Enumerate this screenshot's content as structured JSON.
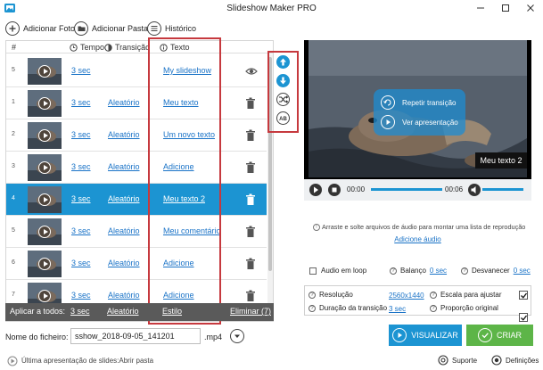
{
  "window": {
    "title": "Slideshow Maker PRO"
  },
  "toolbar": {
    "add_photo": "Adicionar Foto",
    "add_folder": "Adicionar Pasta",
    "history": "Histórico"
  },
  "table": {
    "headers": {
      "index": "#",
      "time": "Tempo",
      "transition": "Transição",
      "text": "Texto"
    },
    "rows": [
      {
        "index": "5",
        "time": "3 sec",
        "transition": "",
        "text": "My slideshow",
        "action": "eye-icon",
        "selected": false
      },
      {
        "index": "1",
        "time": "3 sec",
        "transition": "Aleatório",
        "text": "Meu texto",
        "action": "trash-icon",
        "selected": false
      },
      {
        "index": "2",
        "time": "3 sec",
        "transition": "Aleatório",
        "text": "Um novo texto",
        "action": "trash-icon",
        "selected": false
      },
      {
        "index": "3",
        "time": "3 sec",
        "transition": "Aleatório",
        "text": "Adicione",
        "action": "trash-icon",
        "selected": false
      },
      {
        "index": "4",
        "time": "3 sec",
        "transition": "Aleatório",
        "text": "Meu texto 2",
        "action": "trash-icon",
        "selected": true
      },
      {
        "index": "5",
        "time": "3 sec",
        "transition": "Aleatório",
        "text": "Meu comentário",
        "action": "trash-icon",
        "selected": false
      },
      {
        "index": "6",
        "time": "3 sec",
        "transition": "Aleatório",
        "text": "Adicione",
        "action": "trash-icon",
        "selected": false
      },
      {
        "index": "7",
        "time": "3 sec",
        "transition": "Aleatório",
        "text": "Adicione",
        "action": "trash-icon",
        "selected": false
      }
    ]
  },
  "side_tools": [
    "arrow-up-icon",
    "arrow-down-icon",
    "shuffle-icon",
    "ab-text-icon"
  ],
  "apply_all": {
    "label": "Aplicar a todos:",
    "time": "3 sec",
    "transition": "Aleatório",
    "style": "Estilo",
    "remove": "Eliminar (7)"
  },
  "filename": {
    "label": "Nome do ficheiro:",
    "value": "sshow_2018-09-05_141201",
    "extension": ".mp4"
  },
  "preview": {
    "caption": "Meu texto 2",
    "overlay_repeat": "Repetir transição",
    "overlay_view": "Ver apresentação",
    "time_current": "00:00",
    "time_total": "00:06",
    "progress": 0,
    "volume": 1
  },
  "audio": {
    "drop_hint": "Arraste e solte arquivos de áudio para montar uma lista de reprodução",
    "add_link": "Adicione áudio",
    "loop_label": "Audio em loop",
    "balance_label": "Balanço",
    "balance_value": "0 sec",
    "fade_label": "Desvanecer",
    "fade_value": "0 sec"
  },
  "settings": {
    "resolution_label": "Resolução",
    "resolution_value": "2560x1440",
    "duration_label": "Duração da transição",
    "duration_value": "3 sec",
    "scale_label": "Escala para ajustar",
    "proportion_label": "Proporção original",
    "scale_checked": true,
    "proportion_checked": true
  },
  "actions": {
    "preview": "VISUALIZAR",
    "create": "CRIAR"
  },
  "status": {
    "last_slideshow": "Última apresentação de slides:Abrir pasta",
    "support": "Suporte",
    "settings": "Definições"
  },
  "colors": {
    "accent": "#1c94d2",
    "create": "#5db548",
    "highlight_border": "#c6393e",
    "link": "#1a73c7"
  }
}
